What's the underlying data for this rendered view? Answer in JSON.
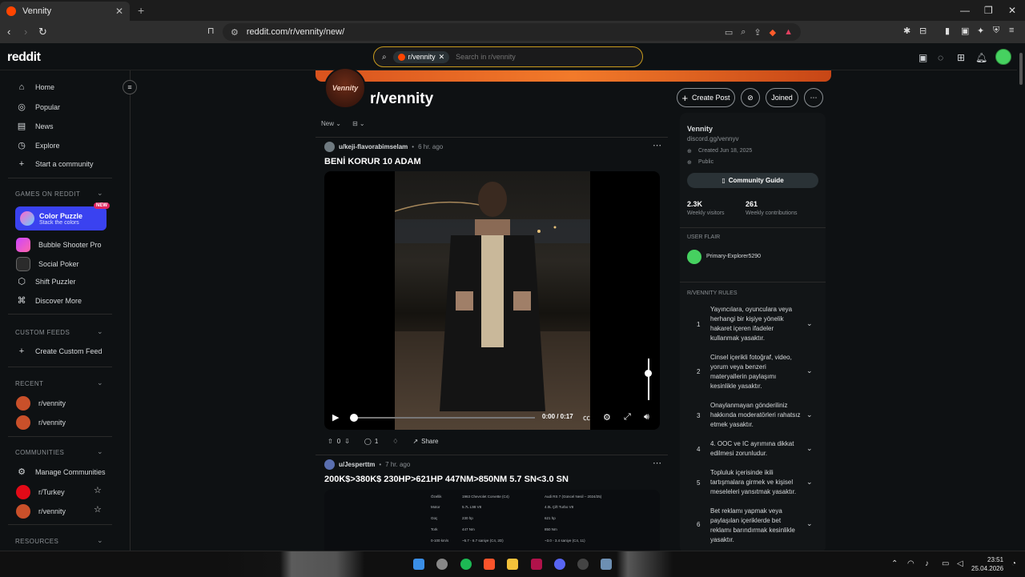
{
  "browser": {
    "tab_title": "Vennity",
    "url": "reddit.com/r/vennity/new/"
  },
  "header": {
    "logo": "reddit",
    "search_chip": "r/vennity",
    "search_placeholder": "Search in r/vennity"
  },
  "sidebar": {
    "top": [
      {
        "label": "Home",
        "icon": "home-icon"
      },
      {
        "label": "Popular",
        "icon": "popular-icon"
      },
      {
        "label": "News",
        "icon": "news-icon"
      },
      {
        "label": "Explore",
        "icon": "explore-icon"
      },
      {
        "label": "Start a community",
        "icon": "plus-icon"
      }
    ],
    "games_title": "GAMES ON REDDIT",
    "featured_game": {
      "title": "Color Puzzle",
      "subtitle": "Stack the colors",
      "badge": "NEW"
    },
    "games": [
      "Bubble Shooter Pro",
      "Social Poker",
      "Shift Puzzler",
      "Discover More"
    ],
    "custom_feeds_title": "CUSTOM FEEDS",
    "create_feed": "Create Custom Feed",
    "recent_title": "RECENT",
    "recent": [
      "r/vennity",
      "r/vennity"
    ],
    "communities_title": "COMMUNITIES",
    "manage": "Manage Communities",
    "communities": [
      "r/Turkey",
      "r/vennity"
    ],
    "resources_title": "RESOURCES"
  },
  "subreddit": {
    "avatar_text": "Vennity",
    "title": "r/vennity",
    "create_post": "Create Post",
    "joined": "Joined"
  },
  "sort": {
    "label": "New"
  },
  "posts": [
    {
      "author": "u/keji-flavorabimselam",
      "time": "6 hr. ago",
      "title": "BENİ KORUR 10 ADAM",
      "video_time": "0:00 / 0:17",
      "votes": "0",
      "comments": "1",
      "share": "Share"
    },
    {
      "author": "u/Jesperttm",
      "time": "7 hr. ago",
      "title": "200K$>380K$ 230HP>621HP 447NM>850NM 5.7 SN<3.0 SN",
      "specs": [
        [
          "Özellik",
          "1963 Chevrolet Corvette (C4)",
          "Audi RS 7 (Güncel Nesil – 2024/25)"
        ],
        [
          "Motor",
          "5.7L L98 V8",
          "4.0L Çift Turbo V8"
        ],
        [
          "Güç",
          "230 hp",
          "621 hp"
        ],
        [
          "Tork",
          "447 Nm",
          "850 Nm"
        ],
        [
          "0-100 km/s",
          "~5.7 - 6.7 saniye (C4, 2D)",
          "~3.0 - 3.4 saniye (C4, 11)"
        ]
      ]
    }
  ],
  "about": {
    "name": "Vennity",
    "link": "discord.gg/vennyv",
    "created": "Created Jun 18, 2025",
    "visibility": "Public",
    "guide": "Community Guide",
    "visitors_num": "2.3K",
    "visitors_label": "Weekly visitors",
    "contrib_num": "261",
    "contrib_label": "Weekly contributions",
    "flair_title": "USER FLAIR",
    "flair_user": "Primary-Explorer5290",
    "rules_title": "R/VENNITY RULES",
    "rules": [
      {
        "num": "1",
        "text": "Yayıncılara, oyunculara veya herhangi bir kişiye yönelik hakaret içeren ifadeler kullanmak yasaktır."
      },
      {
        "num": "2",
        "text": "Cinsel içerikli fotoğraf, video, yorum veya benzeri materyallerin paylaşımı kesinlikle yasaktır."
      },
      {
        "num": "3",
        "text": "Onaylanmayan gönderiliniz hakkında moderatörleri rahatsız etmek yasaktır."
      },
      {
        "num": "4",
        "text": "4. OOC ve IC ayrımına dikkat edilmesi zorunludur."
      },
      {
        "num": "5",
        "text": "Topluluk içerisinde ikili tartışmalara girmek ve kişisel meseleleri yansıtmak yasaktır."
      },
      {
        "num": "6",
        "text": "Bet reklamı yapmak veya paylaşılan içeriklerde bet reklamı barındırmak kesinlikle yasaktır."
      }
    ]
  },
  "taskbar": {
    "time": "23:51",
    "date": "25.04.2026"
  },
  "colors": {
    "accent": "#ff4500",
    "search_border": "#c79a1e",
    "featured_game_bg": "#3a42f0"
  }
}
